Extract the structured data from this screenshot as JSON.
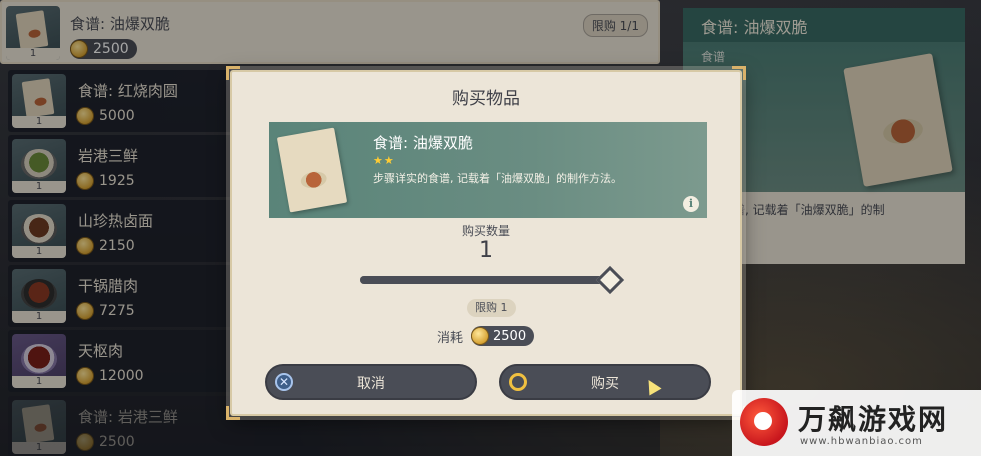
{
  "shop": {
    "items": [
      {
        "name": "食谱: 油爆双脆",
        "price": "2500",
        "count": "1",
        "limit": "限购 1/1"
      },
      {
        "name": "食谱: 红烧肉圆",
        "price": "5000",
        "count": "1"
      },
      {
        "name": "岩港三鲜",
        "price": "1925",
        "count": "1"
      },
      {
        "name": "山珍热卤面",
        "price": "2150",
        "count": "1"
      },
      {
        "name": "干锅腊肉",
        "price": "7275",
        "count": "1"
      },
      {
        "name": "天枢肉",
        "price": "12000",
        "count": "1"
      },
      {
        "name": "食谱: 岩港三鲜",
        "price": "2500",
        "count": "1"
      }
    ]
  },
  "detail": {
    "title": "食谱: 油爆双脆",
    "type": "食谱",
    "desc": "实的食谱, 记载着「油爆双脆」的制"
  },
  "dialog": {
    "title": "购买物品",
    "item_name": "食谱: 油爆双脆",
    "stars": "★★",
    "item_desc": "步骤详实的食谱, 记载着「油爆双脆」的制作方法。",
    "info_icon": "i",
    "qty_label": "购买数量",
    "qty_value": "1",
    "slider_fraction": 1.0,
    "limit": "限购 1",
    "cost_label": "消耗",
    "cost_value": "2500",
    "cancel_label": "取消",
    "buy_label": "购买",
    "cancel_icon": "✕",
    "buy_icon": "○"
  },
  "watermark": {
    "text": "万飙游戏网",
    "url": "www.hbwanbiao.com"
  },
  "colors": {
    "panel": "#ece5d8",
    "dark": "#4a4d56",
    "teal": "#5a8479",
    "gold": "#d9b26a"
  }
}
